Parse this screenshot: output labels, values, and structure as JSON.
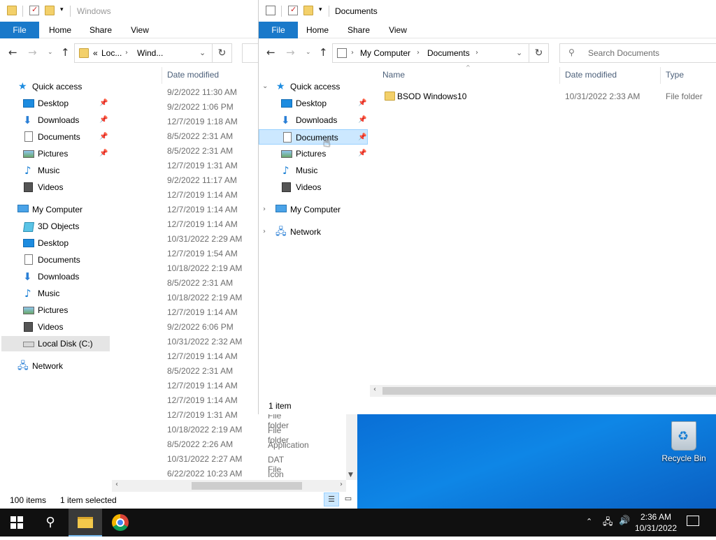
{
  "desktop": {
    "recycle_bin_label": "Recycle Bin"
  },
  "win1": {
    "title": "Windows",
    "ribbon": {
      "file": "File",
      "home": "Home",
      "share": "Share",
      "view": "View"
    },
    "address": {
      "prefix": "«",
      "seg1": "Loc...",
      "seg2": "Wind..."
    },
    "nav": {
      "quick_access": "Quick access",
      "qa_items": [
        "Desktop",
        "Downloads",
        "Documents",
        "Pictures",
        "Music",
        "Videos"
      ],
      "my_computer": "My Computer",
      "pc_items": [
        "3D Objects",
        "Desktop",
        "Documents",
        "Downloads",
        "Music",
        "Pictures",
        "Videos",
        "Local Disk (C:)"
      ],
      "network": "Network"
    },
    "columns": {
      "date_modified": "Date modified"
    },
    "dates": [
      "9/2/2022 11:30 AM",
      "9/2/2022 1:06 PM",
      "12/7/2019 1:18 AM",
      "8/5/2022 2:31 AM",
      "8/5/2022 2:31 AM",
      "12/7/2019 1:31 AM",
      "9/2/2022 11:17 AM",
      "12/7/2019 1:14 AM",
      "12/7/2019 1:14 AM",
      "12/7/2019 1:14 AM",
      "10/31/2022 2:29 AM",
      "12/7/2019 1:54 AM",
      "10/18/2022 2:19 AM",
      "8/5/2022 2:31 AM",
      "10/18/2022 2:19 AM",
      "12/7/2019 1:14 AM",
      "9/2/2022 6:06 PM",
      "10/31/2022 2:32 AM",
      "12/7/2019 1:14 AM",
      "8/5/2022 2:31 AM",
      "12/7/2019 1:14 AM",
      "12/7/2019 1:14 AM",
      "12/7/2019 1:31 AM",
      "10/18/2022 2:19 AM",
      "8/5/2022 2:26 AM",
      "10/31/2022 2:27 AM",
      "6/22/2022 10:23 AM"
    ],
    "types": [
      "File folder",
      "File folder",
      "Application",
      "DAT File",
      "Icon"
    ],
    "status": {
      "items": "100 items",
      "selected": "1 item selected"
    }
  },
  "win2": {
    "title": "Documents",
    "ribbon": {
      "file": "File",
      "home": "Home",
      "share": "Share",
      "view": "View"
    },
    "address": {
      "seg1": "My Computer",
      "seg2": "Documents"
    },
    "search_placeholder": "Search Documents",
    "nav": {
      "quick_access": "Quick access",
      "qa_items": [
        "Desktop",
        "Downloads",
        "Documents",
        "Pictures",
        "Music",
        "Videos"
      ],
      "my_computer": "My Computer",
      "network": "Network"
    },
    "columns": {
      "name": "Name",
      "date_modified": "Date modified",
      "type": "Type"
    },
    "files": [
      {
        "name": "BSOD Windows10",
        "date": "10/31/2022 2:33 AM",
        "type": "File folder"
      }
    ],
    "status": {
      "items": "1 item"
    }
  },
  "taskbar": {
    "time": "2:36 AM",
    "date": "10/31/2022"
  }
}
